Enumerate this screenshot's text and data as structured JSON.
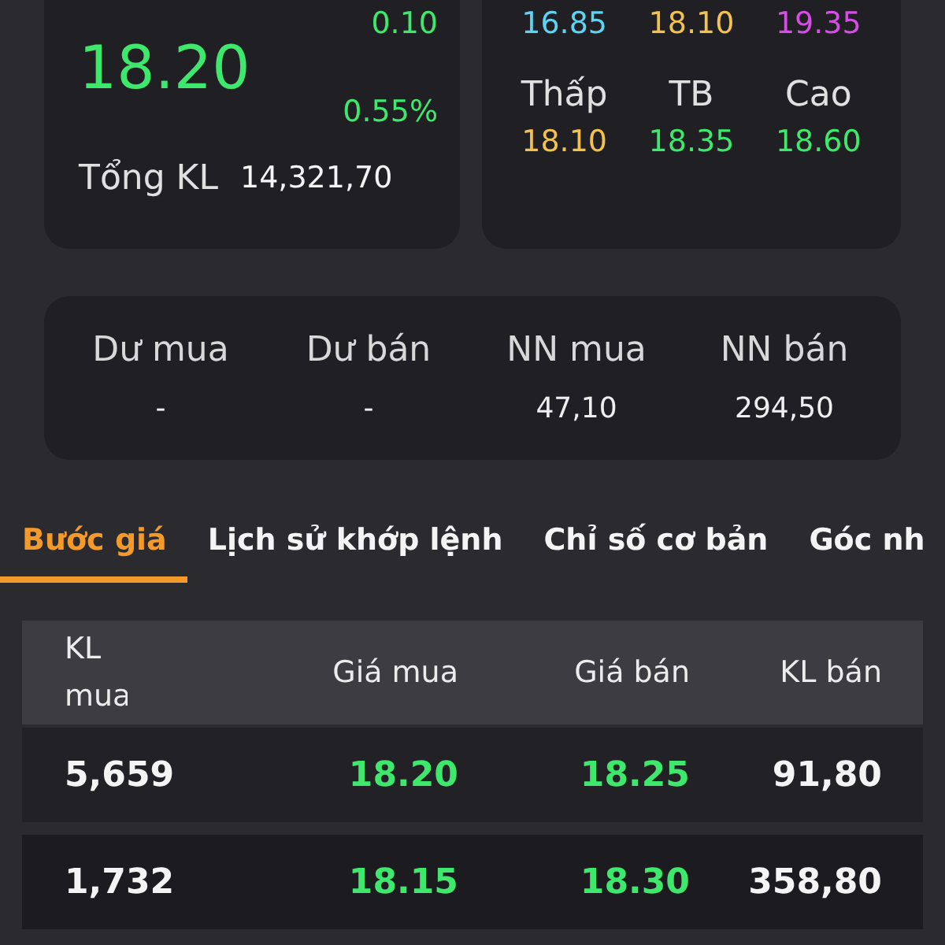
{
  "quote": {
    "price": "18.20",
    "change": "0.10",
    "change_percent": "0.55%",
    "total_volume_label": "Tổng KL",
    "total_volume": "14,321,70"
  },
  "price_levels": {
    "reference_values": [
      {
        "value": "16.85",
        "color": "#5ed4f2"
      },
      {
        "value": "18.10",
        "color": "#f2c14e"
      },
      {
        "value": "19.35",
        "color": "#d64de6"
      }
    ],
    "stats": [
      {
        "label": "Thấp",
        "value": "18.10",
        "color": "#f2c14e"
      },
      {
        "label": "TB",
        "value": "18.35",
        "color": "#3de86c"
      },
      {
        "label": "Cao",
        "value": "18.60",
        "color": "#3de86c"
      }
    ]
  },
  "balance": [
    {
      "label": "Dư mua",
      "value": "-"
    },
    {
      "label": "Dư bán",
      "value": "-"
    },
    {
      "label": "NN mua",
      "value": "47,10"
    },
    {
      "label": "NN bán",
      "value": "294,50"
    }
  ],
  "tabs": [
    {
      "label": "Bước giá",
      "selected": true
    },
    {
      "label": "Lịch sử khớp lệnh",
      "selected": false
    },
    {
      "label": "Chỉ số cơ bản",
      "selected": false
    },
    {
      "label": "Góc nh",
      "selected": false
    }
  ],
  "order_book": {
    "columns": [
      "KL mua",
      "Giá mua",
      "Giá bán",
      "KL bán"
    ],
    "rows": [
      {
        "buy_volume": "5,659",
        "buy_price": "18.20",
        "sell_price": "18.25",
        "sell_volume": "91,80"
      },
      {
        "buy_volume": "1,732",
        "buy_price": "18.15",
        "sell_price": "18.30",
        "sell_volume": "358,80"
      }
    ]
  }
}
